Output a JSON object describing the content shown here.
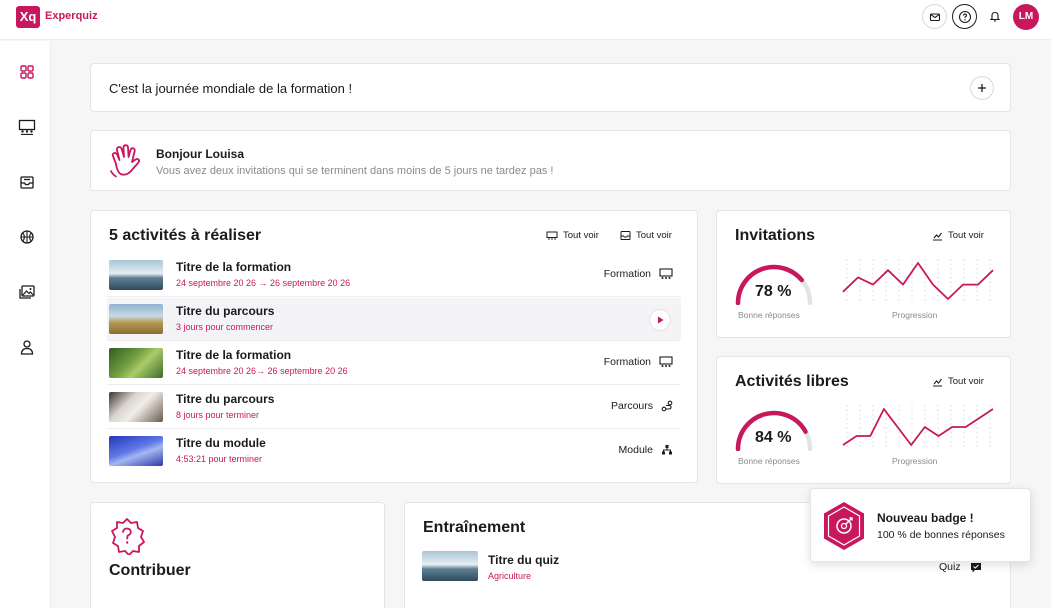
{
  "app": {
    "logo": "Xq",
    "name": "Experquiz"
  },
  "header": {
    "icons": [
      "mail-icon",
      "help-icon",
      "bell-icon"
    ],
    "avatar_initials": "LM"
  },
  "sidebar": {
    "items": [
      "dashboard-icon",
      "training-icon",
      "inbox-icon",
      "basketball-icon",
      "gallery-icon",
      "user-icon"
    ]
  },
  "banner": {
    "text": "C'est la journée mondiale de la formation !"
  },
  "greeting": {
    "title": "Bonjour Louisa",
    "subtitle": "Vous avez deux invitations qui se terminent dans moins de 5 jours ne tardez pas !"
  },
  "activities": {
    "title": "5 activités à réaliser",
    "link_1": "Tout voir",
    "link_2": "Tout voir",
    "rows": [
      {
        "title": "Titre de la formation",
        "subtitle": "24 septembre 20 26 → 26 septembre 20 26",
        "type": "Formation",
        "thumb": "glacier"
      },
      {
        "title": "Titre du parcours",
        "subtitle": "3 jours pour commencer",
        "type": "",
        "thumb": "savanna"
      },
      {
        "title": "Titre de la formation",
        "subtitle": "24 septembre 20 26→ 26 septembre 20 26",
        "type": "Formation",
        "thumb": "forest"
      },
      {
        "title": "Titre du parcours",
        "subtitle": "8 jours pour terminer",
        "type": "Parcours",
        "thumb": "sketch"
      },
      {
        "title": "Titre du module",
        "subtitle": "4:53:21 pour terminer",
        "type": "Module",
        "thumb": "blue"
      }
    ]
  },
  "invitations": {
    "title": "Invitations",
    "link": "Tout voir",
    "percent": "78 %",
    "percent_value": 78,
    "gauge_label": "Bonne réponses",
    "spark_label": "Progression",
    "spark": [
      3,
      5,
      4,
      6,
      4,
      7,
      4,
      2,
      4,
      4,
      6
    ]
  },
  "free": {
    "title": "Activités libres",
    "link": "Tout voir",
    "percent": "84 %",
    "percent_value": 84,
    "gauge_label": "Bonne réponses",
    "spark_label": "Progression",
    "spark": [
      3,
      4,
      4,
      7,
      5,
      3,
      5,
      4,
      5,
      5,
      6,
      7
    ]
  },
  "contribute": {
    "title": "Contribuer"
  },
  "training": {
    "title": "Entraînement",
    "quiz_title": "Titre du quiz",
    "quiz_sub": "Agriculture",
    "quiz_type": "Quiz"
  },
  "toast": {
    "title": "Nouveau badge !",
    "subtitle": "100 % de bonnes réponses"
  },
  "colors": {
    "accent": "#c8175d",
    "gauge_track": "#e3e3e6"
  }
}
